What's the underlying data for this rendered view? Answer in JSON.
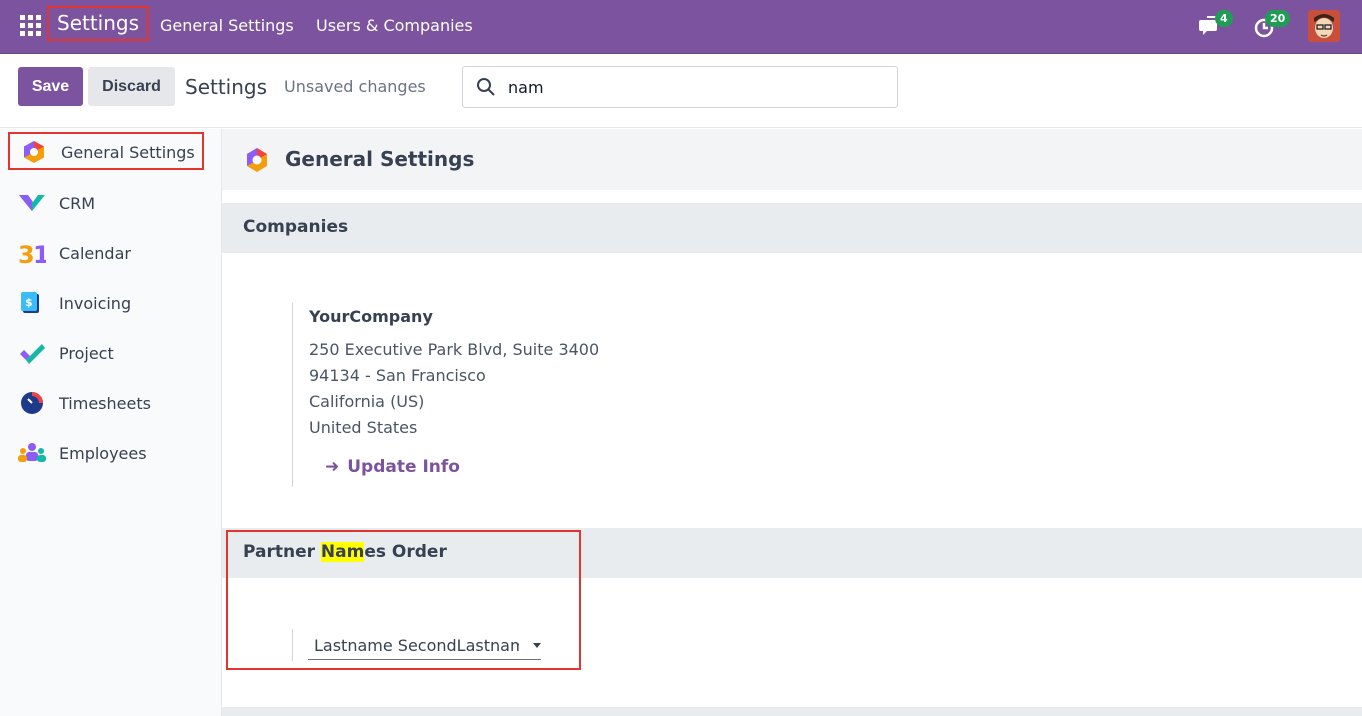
{
  "navbar": {
    "brand": "Settings",
    "menu": [
      "General Settings",
      "Users & Companies"
    ],
    "messages_count": "4",
    "activities_count": "20"
  },
  "control_panel": {
    "save_label": "Save",
    "discard_label": "Discard",
    "title": "Settings",
    "status": "Unsaved changes",
    "search_value": "nam"
  },
  "sidebar": {
    "items": [
      {
        "label": "General Settings",
        "icon": "general-settings-icon"
      },
      {
        "label": "CRM",
        "icon": "crm-icon"
      },
      {
        "label": "Calendar",
        "icon": "calendar-icon"
      },
      {
        "label": "Invoicing",
        "icon": "invoicing-icon"
      },
      {
        "label": "Project",
        "icon": "project-icon"
      },
      {
        "label": "Timesheets",
        "icon": "timesheets-icon"
      },
      {
        "label": "Employees",
        "icon": "employees-icon"
      }
    ]
  },
  "main": {
    "app_title": "General Settings",
    "companies_title": "Companies",
    "company": {
      "name": "YourCompany",
      "address": [
        "250 Executive Park Blvd, Suite 3400",
        "94134 - San Francisco",
        "California (US)",
        "United States"
      ],
      "update_label": "Update Info"
    },
    "partner_names": {
      "title_prefix": "Partner ",
      "title_highlight": "Nam",
      "title_suffix": "es Order",
      "selected": "Lastname SecondLastname"
    }
  },
  "colors": {
    "brand": "#7c539e",
    "highlight": "#ffff00",
    "annotation_box": "#e3342f",
    "badge": "#1f9d55"
  }
}
